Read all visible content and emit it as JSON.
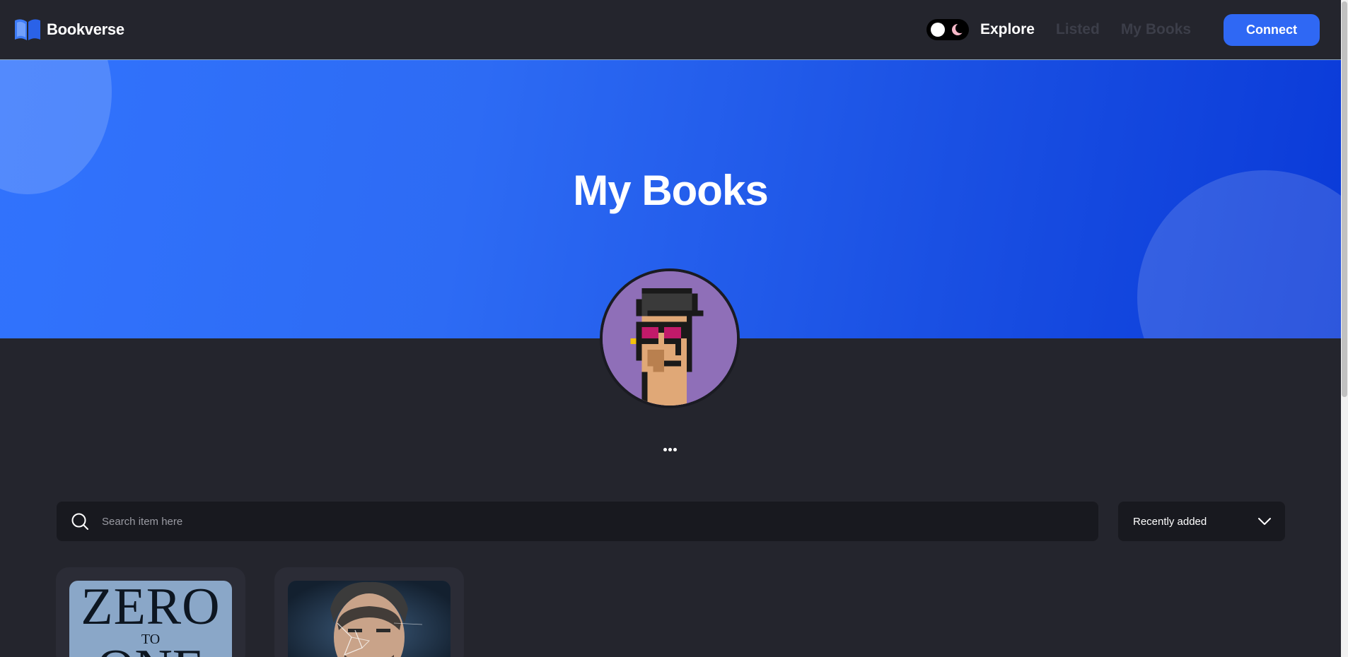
{
  "brand": {
    "name": "Bookverse",
    "logo_icon": "open-book-icon"
  },
  "nav": {
    "links": [
      {
        "label": "Explore",
        "active": true
      },
      {
        "label": "Listed",
        "active": false
      },
      {
        "label": "My Books",
        "active": false
      }
    ],
    "connect_label": "Connect",
    "theme_toggle_icon": "moon-icon"
  },
  "hero": {
    "title": "My Books"
  },
  "profile": {
    "avatar_icon": "pixel-punk-avatar-icon",
    "menu_icon": "more-dots-icon"
  },
  "search": {
    "placeholder": "Search item here",
    "icon": "search-icon"
  },
  "sort": {
    "selected": "Recently added",
    "icon": "chevron-down-icon"
  },
  "books": [
    {
      "cover_line1": "ZERO",
      "cover_line2": "TO",
      "cover_line3": "ONE"
    },
    {
      "cover_image": "portrait-cover"
    }
  ],
  "colors": {
    "background": "#24252d",
    "hero_blue": "#2d6bf4",
    "accent": "#2f68f4",
    "card": "#2b2c36",
    "input": "#18191f",
    "muted_text": "#3c3e49"
  }
}
